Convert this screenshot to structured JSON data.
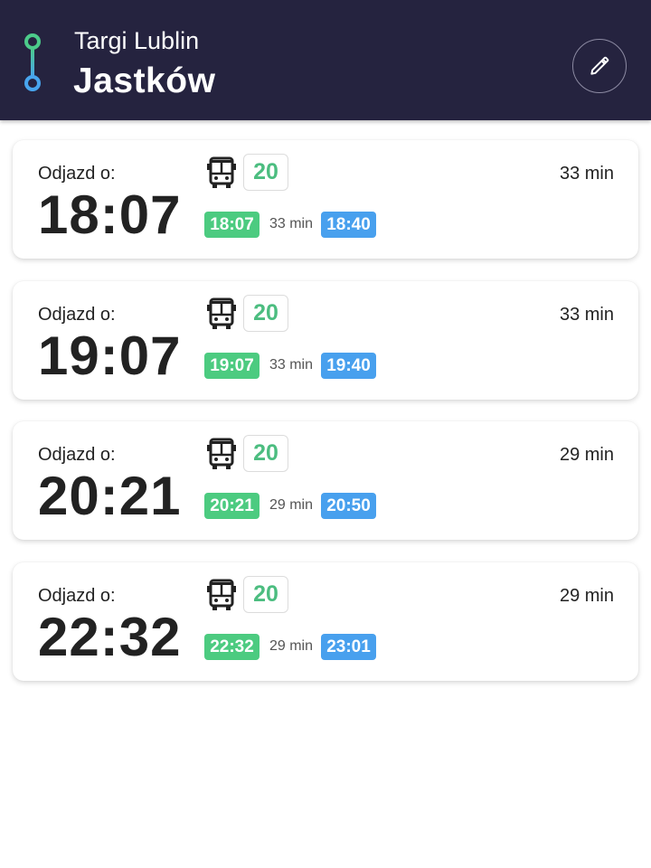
{
  "header": {
    "from": "Targi Lublin",
    "to": "Jastków",
    "from_color": "#4ccb8a",
    "to_color": "#48a5ee",
    "background": "#25233f",
    "edit_icon": "pencil-icon"
  },
  "departures": [
    {
      "label": "Odjazd o:",
      "time": "18:07",
      "line": "20",
      "duration": "33 min",
      "dep": "18:07",
      "mid": "33 min",
      "arr": "18:40"
    },
    {
      "label": "Odjazd o:",
      "time": "19:07",
      "line": "20",
      "duration": "33 min",
      "dep": "19:07",
      "mid": "33 min",
      "arr": "19:40"
    },
    {
      "label": "Odjazd o:",
      "time": "20:21",
      "line": "20",
      "duration": "29 min",
      "dep": "20:21",
      "mid": "29 min",
      "arr": "20:50"
    },
    {
      "label": "Odjazd o:",
      "time": "22:32",
      "line": "20",
      "duration": "29 min",
      "dep": "22:32",
      "mid": "29 min",
      "arr": "23:01"
    }
  ],
  "colors": {
    "line_green": "#4cbd80",
    "dep_pill": "#4ccb80",
    "arr_pill": "#48a0ee"
  },
  "icons": {
    "vehicle": "bus-icon"
  }
}
